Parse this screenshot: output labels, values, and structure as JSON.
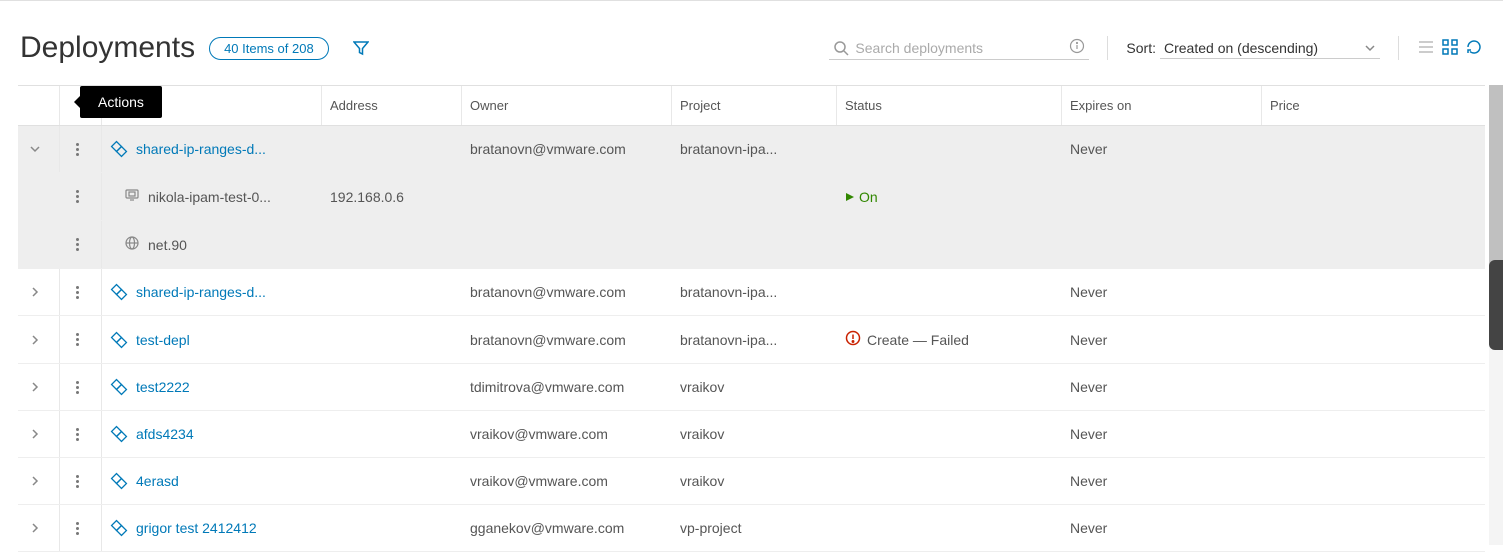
{
  "header": {
    "title": "Deployments",
    "item_count": "40 Items of 208",
    "search_placeholder": "Search deployments",
    "sort_label": "Sort:",
    "sort_value": "Created on (descending)"
  },
  "tooltip": "Actions",
  "columns": {
    "name": "",
    "address": "Address",
    "owner": "Owner",
    "project": "Project",
    "status": "Status",
    "expires": "Expires on",
    "price": "Price"
  },
  "rows": [
    {
      "expanded": true,
      "name": "shared-ip-ranges-d...",
      "address": "",
      "owner": "bratanovn@vmware.com",
      "project": "bratanovn-ipa...",
      "status": "",
      "expires": "Never",
      "price": "",
      "children": [
        {
          "icon": "vm",
          "name": "nikola-ipam-test-0...",
          "address": "192.168.0.6",
          "status_on": "On"
        },
        {
          "icon": "net",
          "name": "net.90",
          "address": "",
          "status_on": ""
        }
      ]
    },
    {
      "expanded": false,
      "name": "shared-ip-ranges-d...",
      "address": "",
      "owner": "bratanovn@vmware.com",
      "project": "bratanovn-ipa...",
      "status": "",
      "expires": "Never",
      "price": ""
    },
    {
      "expanded": false,
      "name": "test-depl",
      "address": "",
      "owner": "bratanovn@vmware.com",
      "project": "bratanovn-ipa...",
      "status": "Create — Failed",
      "status_fail": true,
      "expires": "Never",
      "price": ""
    },
    {
      "expanded": false,
      "name": "test2222",
      "address": "",
      "owner": "tdimitrova@vmware.com",
      "project": "vraikov",
      "status": "",
      "expires": "Never",
      "price": ""
    },
    {
      "expanded": false,
      "name": "afds4234",
      "address": "",
      "owner": "vraikov@vmware.com",
      "project": "vraikov",
      "status": "",
      "expires": "Never",
      "price": ""
    },
    {
      "expanded": false,
      "name": "4erasd",
      "address": "",
      "owner": "vraikov@vmware.com",
      "project": "vraikov",
      "status": "",
      "expires": "Never",
      "price": ""
    },
    {
      "expanded": false,
      "name": "grigor test 2412412",
      "address": "",
      "owner": "gganekov@vmware.com",
      "project": "vp-project",
      "status": "",
      "expires": "Never",
      "price": ""
    }
  ]
}
